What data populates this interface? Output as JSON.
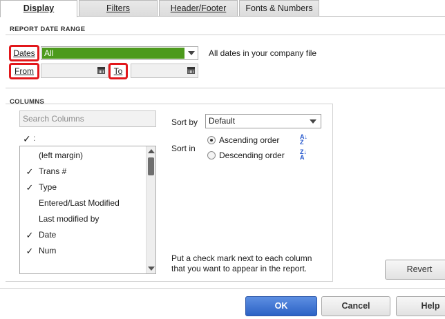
{
  "tabs": [
    {
      "label": "Display",
      "accesskey": "D"
    },
    {
      "label": "Filters",
      "accesskey": "F"
    },
    {
      "label": "Header/Footer",
      "accesskey": "H"
    },
    {
      "label": "Fonts & Numbers",
      "accesskey": "n"
    }
  ],
  "report_date_range": {
    "title": "REPORT DATE RANGE",
    "dates_label": "Dates",
    "dates_value": "All",
    "dates_description": "All dates in your company file",
    "from_label": "From",
    "from_value": "",
    "to_label": "To",
    "to_value": ""
  },
  "columns": {
    "title": "COLUMNS",
    "search_placeholder": "Search Columns",
    "header_check": "✓",
    "header_dots": ":",
    "items": [
      {
        "checked": "",
        "label": "(left margin)"
      },
      {
        "checked": "✓",
        "label": "Trans #"
      },
      {
        "checked": "✓",
        "label": "Type"
      },
      {
        "checked": "",
        "label": "Entered/Last Modified"
      },
      {
        "checked": "",
        "label": "Last modified by"
      },
      {
        "checked": "✓",
        "label": "Date"
      },
      {
        "checked": "✓",
        "label": "Num"
      }
    ],
    "sort_by_label": "Sort by",
    "sort_by_value": "Default",
    "sort_in_label": "Sort in",
    "ascending_label": "Ascending order",
    "descending_label": "Descending order",
    "sort_order_selected": "ascending",
    "hint": "Put a check mark next to each column that you want to appear in the report.",
    "hint_line1": "Put a check mark next to each column",
    "hint_line2": "that you want to appear in the report."
  },
  "buttons": {
    "revert": "Revert",
    "ok": "OK",
    "cancel": "Cancel",
    "help": "Help"
  },
  "colors": {
    "accent_green": "#4c9a1c",
    "highlight_red": "#e2171b",
    "ok_blue": "#2c62c5"
  }
}
